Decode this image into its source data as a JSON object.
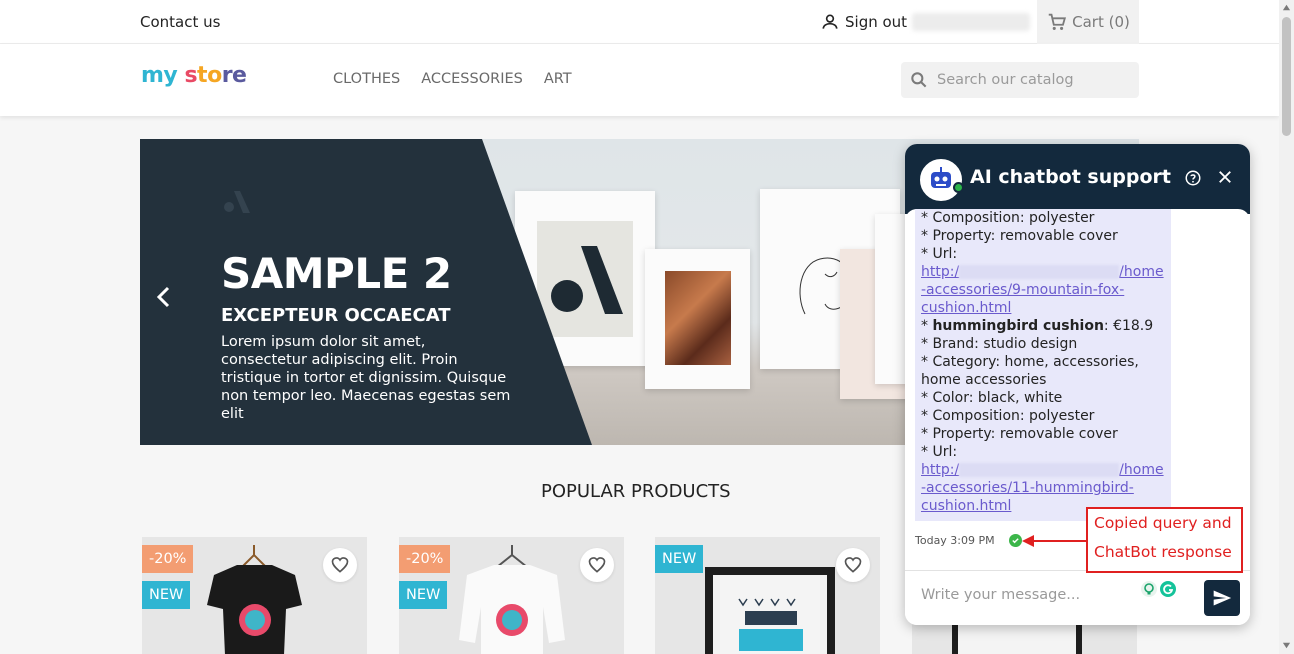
{
  "topbar": {
    "contact": "Contact us",
    "sign_out": "Sign out",
    "cart": "Cart (0)"
  },
  "header": {
    "logo": {
      "part1": "my",
      "part2": "s",
      "part3": "to",
      "part4": "re"
    },
    "nav": [
      "CLOTHES",
      "ACCESSORIES",
      "ART"
    ],
    "search_placeholder": "Search our catalog"
  },
  "hero": {
    "title": "SAMPLE 2",
    "subtitle": "EXCEPTEUR OCCAECAT",
    "text": "Lorem ipsum dolor sit amet, consectetur adipiscing elit. Proin tristique in tortor et dignissim. Quisque non tempor leo. Maecenas egestas sem elit"
  },
  "popular_title": "POPULAR PRODUCTS",
  "products": [
    {
      "discount": "-20%",
      "new": "NEW"
    },
    {
      "discount": "-20%",
      "new": "NEW"
    },
    {
      "discount": "",
      "new": "NEW"
    },
    {
      "discount": "",
      "new": ""
    }
  ],
  "chat": {
    "title": "AI chatbot support",
    "lines": {
      "l1": "* Composition: polyester",
      "l2": "* Property: removable cover",
      "l3": "* Url:",
      "url1_a": "http:/",
      "url1_b": "/home",
      "url1_c": "-accessories/9-mountain-fox-",
      "url1_d": "cushion.html",
      "l4_bold": "hummingbird cushion",
      "l4_rest": ": €18.9",
      "l5": "* Brand: studio design",
      "l6": "* Category: home, accessories,",
      "l6b": "home accessories",
      "l7": "* Color: black, white",
      "l8": "* Composition: polyester",
      "l9": "* Property: removable cover",
      "l10": "* Url:",
      "url2_a": "http:/",
      "url2_b": "/home",
      "url2_c": "-accessories/11-hummingbird-",
      "url2_d": "cushion.html"
    },
    "timestamp": "Today 3:09 PM",
    "input_placeholder": "Write your message..."
  },
  "annotation": {
    "line1": "Copied query and",
    "line2": "ChatBot response"
  },
  "colors": {
    "accent": "#2fb5d2",
    "chat_header": "#13293d",
    "hero_dark": "#23313c",
    "annotation": "#e02020"
  }
}
